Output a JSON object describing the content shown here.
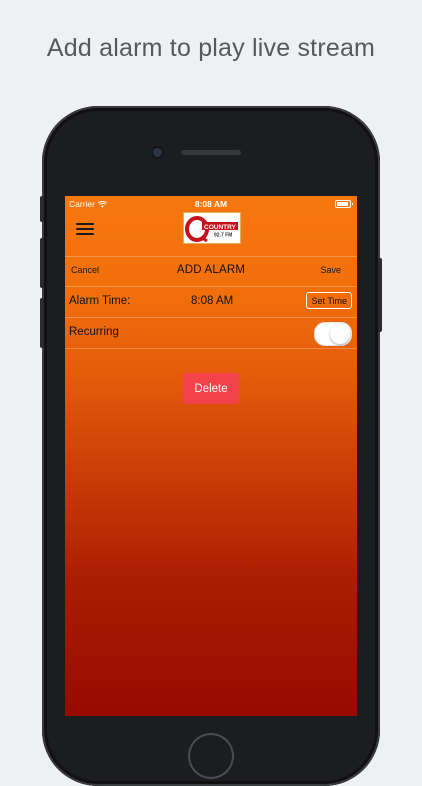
{
  "headline": "Add alarm to play live stream",
  "status_bar": {
    "carrier": "Carrier",
    "time": "8:08 AM"
  },
  "navbar": {
    "logo_text": "COUNTRY",
    "logo_sub": "92.7 FM"
  },
  "header": {
    "cancel_label": "Cancel",
    "title": "ADD ALARM",
    "save_label": "Save"
  },
  "alarm": {
    "time_label": "Alarm Time:",
    "time_value": "8:08 AM",
    "set_time_label": "Set Time",
    "recurring_label": "Recurring",
    "recurring_on": true
  },
  "delete_label": "Delete",
  "colors": {
    "accent_orange": "#f7770f",
    "gradient_bottom": "#970b00",
    "delete_red": "#f2424a"
  },
  "icons": [
    "hamburger-menu-icon",
    "wifi-icon",
    "battery-icon"
  ]
}
